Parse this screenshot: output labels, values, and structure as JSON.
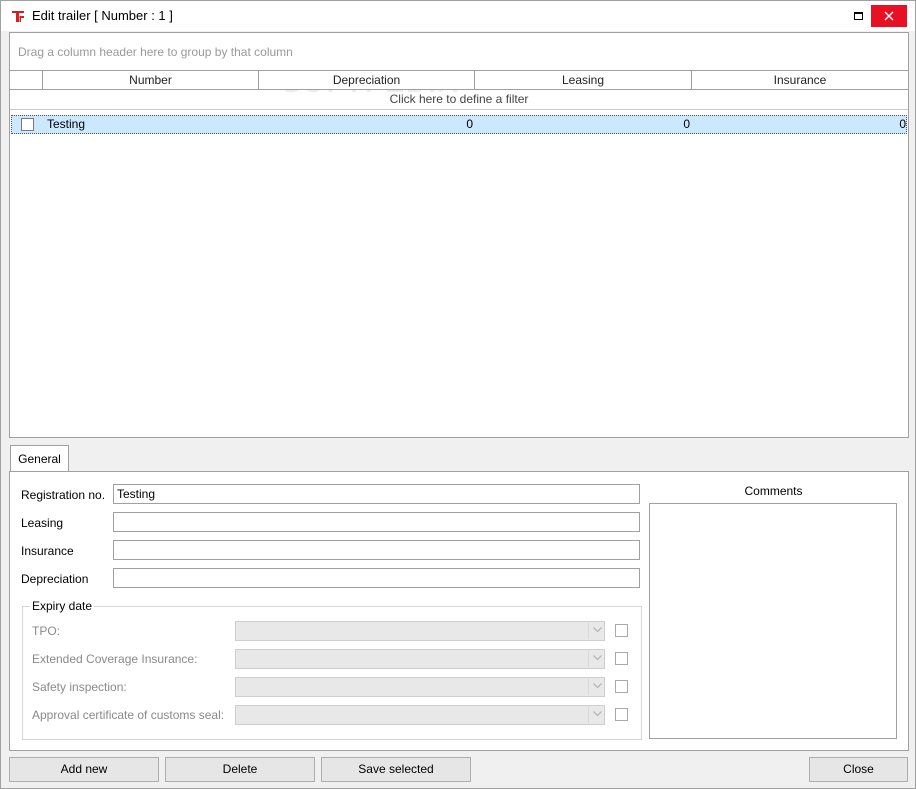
{
  "window": {
    "title": "Edit trailer [ Number : 1 ]",
    "icon": "app-logo-icon",
    "close_color": "#e81123"
  },
  "grid": {
    "group_hint": "Drag a column header here to group by that column",
    "columns": [
      "Number",
      "Depreciation",
      "Leasing",
      "Insurance"
    ],
    "filter_hint": "Click here to define a filter",
    "rows": [
      {
        "number": "Testing",
        "depreciation": "0",
        "leasing": "0",
        "insurance": "0",
        "selected": true
      }
    ],
    "watermark": "SOFTPEDIA",
    "selection_color": "#cce8ff"
  },
  "tabs": [
    "General"
  ],
  "form": {
    "registration_label": "Registration no.",
    "registration_value": "Testing",
    "leasing_label": "Leasing",
    "leasing_value": "",
    "insurance_label": "Insurance",
    "insurance_value": "",
    "depreciation_label": "Depreciation",
    "depreciation_value": "",
    "comments_label": "Comments",
    "comments_value": ""
  },
  "expiry": {
    "legend": "Expiry date",
    "items": [
      {
        "label": "TPO:",
        "value": ""
      },
      {
        "label": "Extended Coverage Insurance:",
        "value": ""
      },
      {
        "label": "Safety inspection:",
        "value": ""
      },
      {
        "label": "Approval certificate of customs seal:",
        "value": ""
      }
    ]
  },
  "buttons": {
    "add_new": "Add new",
    "delete": "Delete",
    "save_selected": "Save selected",
    "close": "Close"
  }
}
